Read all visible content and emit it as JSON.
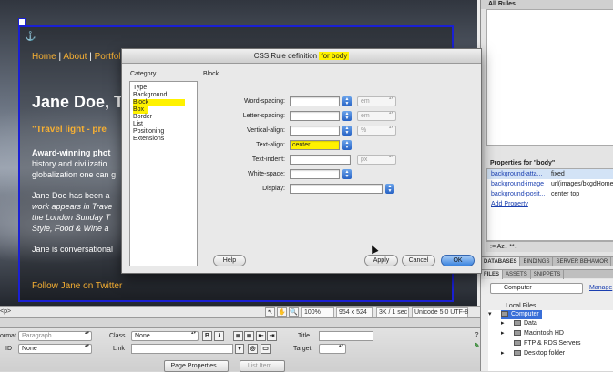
{
  "design_view": {
    "nav": [
      "Home",
      "About",
      "Portfol"
    ],
    "nav_sep": "|",
    "site_name": "Jane Doe, T",
    "tagline": "\"Travel light - pre",
    "paragraphs": [
      "Award-winning phot",
      "history and civilizatio",
      "globalization one can g",
      "Jane Doe has been a",
      "work appears in Trave",
      "the London Sunday T",
      "Style, Food & Wine a",
      "Jane is conversational"
    ],
    "follow_link": "Follow Jane on Twitter"
  },
  "status_bar": {
    "tag_selector": "<p>",
    "zoom": "100%",
    "window_size": "954 x 524",
    "download": "3K / 1 sec",
    "encoding": "Unicode 5.0 UTF-8"
  },
  "property_inspector": {
    "format_label": "ormat",
    "format_value": "Paragraph",
    "class_label": "Class",
    "class_value": "None",
    "bold": "B",
    "italic": "I",
    "title_label": "Title",
    "id_label": "ID",
    "id_value": "None",
    "link_label": "Link",
    "target_label": "Target",
    "page_properties_button": "Page Properties...",
    "list_item_button": "List Item..."
  },
  "right_panels": {
    "all_rules_header": "All Rules",
    "properties_header": "Properties for \"body\"",
    "properties": [
      {
        "name": "background-atta...",
        "value": "fixed"
      },
      {
        "name": "background-image",
        "value": "url(images/bkgdHome..."
      },
      {
        "name": "background-posit...",
        "value": "center top"
      }
    ],
    "add_property": "Add Property",
    "css_toolbar": ":≡ Az↓ **↓",
    "tabs_row1": [
      "DATABASES",
      "BINDINGS",
      "SERVER BEHAVIOR"
    ],
    "tabs_row2": [
      "FILES",
      "ASSETS",
      "SNIPPETS"
    ],
    "files_select": "Computer",
    "manage_link": "Manage",
    "local_files_label": "Local Files",
    "tree": [
      {
        "label": "Computer",
        "selected": true
      },
      {
        "label": "Data",
        "selected": false
      },
      {
        "label": "Macintosh HD",
        "selected": false
      },
      {
        "label": "FTP & RDS Servers",
        "selected": false
      },
      {
        "label": "Desktop folder",
        "selected": false
      }
    ]
  },
  "dialog": {
    "title_prefix": "CSS Rule definition ",
    "title_highlight": "for body",
    "category_label": "Category",
    "section_label": "Block",
    "categories": [
      "Type",
      "Background",
      "Block",
      "Box",
      "Border",
      "List",
      "Positioning",
      "Extensions"
    ],
    "fields": [
      {
        "label": "Word-spacing:",
        "value": "",
        "unit": "em"
      },
      {
        "label": "Letter-spacing:",
        "value": "",
        "unit": "em"
      },
      {
        "label": "Vertical-align:",
        "value": "",
        "unit": "%"
      },
      {
        "label": "Text-align:",
        "value": "center",
        "unit": ""
      },
      {
        "label": "Text-indent:",
        "value": "",
        "unit": "px"
      },
      {
        "label": "White-space:",
        "value": "",
        "unit": ""
      },
      {
        "label": "Display:",
        "value": "",
        "unit": ""
      }
    ],
    "help_button": "Help",
    "apply_button": "Apply",
    "cancel_button": "Cancel",
    "ok_button": "OK"
  },
  "colors": {
    "highlight": "#fff200",
    "site_accent": "#f7b033",
    "selection_blue": "#1a20d4"
  }
}
